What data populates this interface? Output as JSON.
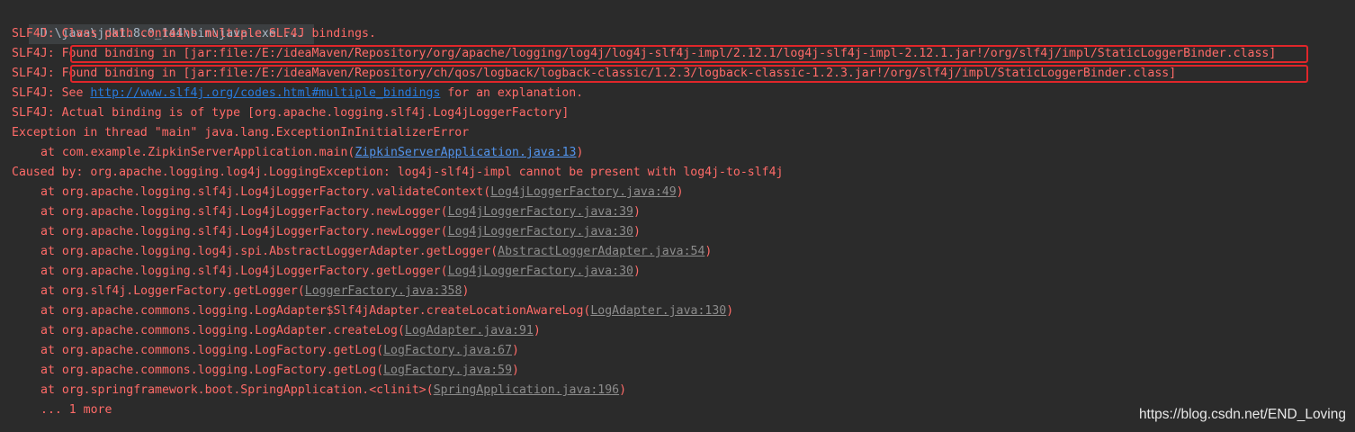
{
  "console": {
    "command": "D:\\java\\jdk1.8.0_144\\bin\\java.exe ...",
    "lines": [
      "SLF4J: Class path contains multiple SLF4J bindings.",
      {
        "prefix": "SLF4J: ",
        "text": "Found binding in [jar:file:/E:/ideaMaven/Repository/org/apache/logging/log4j/log4j-slf4j-impl/2.12.1/log4j-slf4j-impl-2.12.1.jar!/org/slf4j/impl/StaticLoggerBinder.class]"
      },
      {
        "prefix": "SLF4J: ",
        "text": "Found binding in [jar:file:/E:/ideaMaven/Repository/ch/qos/logback/logback-classic/1.2.3/logback-classic-1.2.3.jar!/org/slf4j/impl/StaticLoggerBinder.class]"
      },
      {
        "prefix": "SLF4J: See ",
        "link": "http://www.slf4j.org/codes.html#multiple_bindings",
        "suffix": " for an explanation."
      },
      "SLF4J: Actual binding is of type [org.apache.logging.slf4j.Log4jLoggerFactory]",
      "Exception in thread \"main\" java.lang.ExceptionInInitializerError",
      {
        "prefix": "at com.example.ZipkinServerApplication.main(",
        "link": "ZipkinServerApplication.java:13",
        "suffix": ")"
      },
      "Caused by: org.apache.logging.log4j.LoggingException: log4j-slf4j-impl cannot be present with log4j-to-slf4j",
      {
        "prefix": "at org.apache.logging.slf4j.Log4jLoggerFactory.validateContext(",
        "link": "Log4jLoggerFactory.java:49",
        "suffix": ")"
      },
      {
        "prefix": "at org.apache.logging.slf4j.Log4jLoggerFactory.newLogger(",
        "link": "Log4jLoggerFactory.java:39",
        "suffix": ")"
      },
      {
        "prefix": "at org.apache.logging.slf4j.Log4jLoggerFactory.newLogger(",
        "link": "Log4jLoggerFactory.java:30",
        "suffix": ")"
      },
      {
        "prefix": "at org.apache.logging.log4j.spi.AbstractLoggerAdapter.getLogger(",
        "link": "AbstractLoggerAdapter.java:54",
        "suffix": ")"
      },
      {
        "prefix": "at org.apache.logging.slf4j.Log4jLoggerFactory.getLogger(",
        "link": "Log4jLoggerFactory.java:30",
        "suffix": ")"
      },
      {
        "prefix": "at org.slf4j.LoggerFactory.getLogger(",
        "link": "LoggerFactory.java:358",
        "suffix": ")"
      },
      {
        "prefix": "at org.apache.commons.logging.LogAdapter$Slf4jAdapter.createLocationAwareLog(",
        "link": "LogAdapter.java:130",
        "suffix": ")"
      },
      {
        "prefix": "at org.apache.commons.logging.LogAdapter.createLog(",
        "link": "LogAdapter.java:91",
        "suffix": ")"
      },
      {
        "prefix": "at org.apache.commons.logging.LogFactory.getLog(",
        "link": "LogFactory.java:67",
        "suffix": ")"
      },
      {
        "prefix": "at org.apache.commons.logging.LogFactory.getLog(",
        "link": "LogFactory.java:59",
        "suffix": ")"
      },
      {
        "prefix": "at org.springframework.boot.SpringApplication.<clinit>(",
        "link": "SpringApplication.java:196",
        "suffix": ")"
      },
      "... 1 more"
    ]
  },
  "watermark": "https://blog.csdn.net/END_Loving",
  "colors": {
    "background": "#2b2b2b",
    "error_text": "#ff6b68",
    "command_text": "#a9b7c6",
    "link_blue": "#5394ec",
    "link_gray": "#8c8c8c",
    "highlight_border": "#e0262a"
  }
}
